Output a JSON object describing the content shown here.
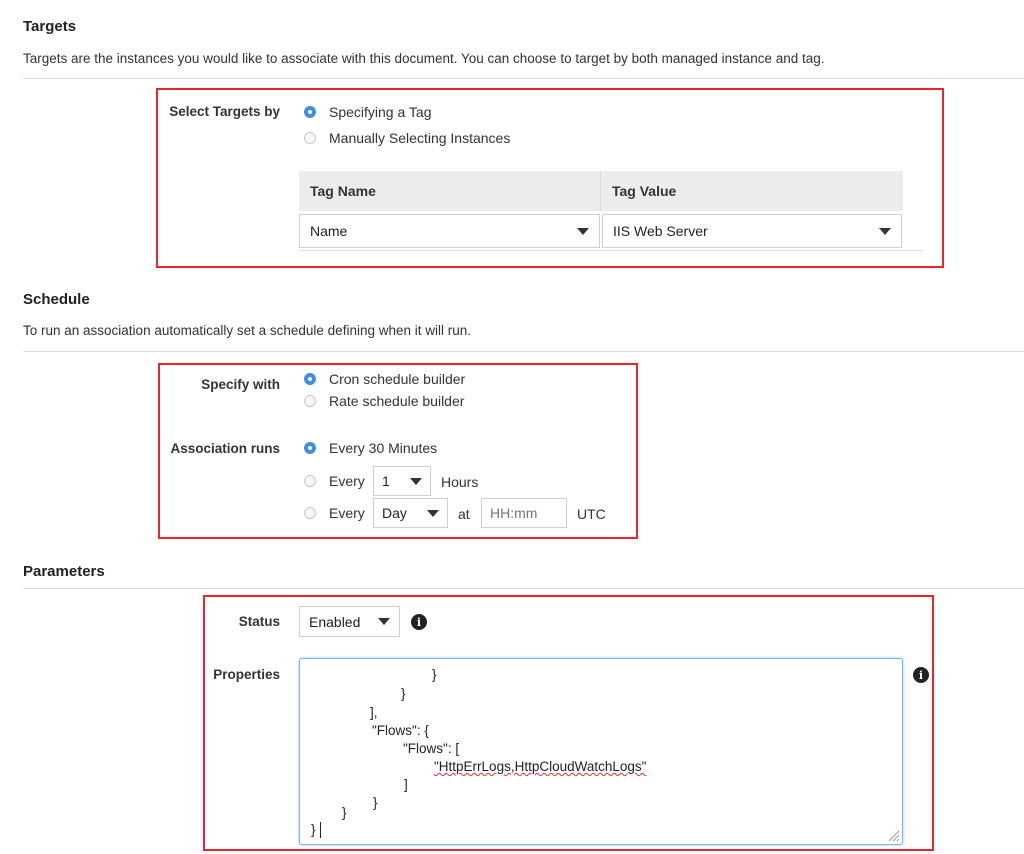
{
  "targets": {
    "heading": "Targets",
    "description": "Targets are the instances you would like to associate with this document. You can choose to target by both managed instance and tag.",
    "select_by_label": "Select Targets by",
    "options": [
      "Specifying a Tag",
      "Manually Selecting Instances"
    ],
    "selected_option": 0,
    "table": {
      "headers": [
        "Tag Name",
        "Tag Value"
      ],
      "tag_name": "Name",
      "tag_value": "IIS Web Server"
    }
  },
  "schedule": {
    "heading": "Schedule",
    "description": "To run an association automatically set a schedule defining when it will run.",
    "specify_with_label": "Specify with",
    "specify_options": [
      "Cron schedule builder",
      "Rate schedule builder"
    ],
    "association_runs_label": "Association runs",
    "run_option_1": "Every 30 Minutes",
    "every_label": "Every",
    "hours_value": "1",
    "hours_label": "Hours",
    "day_value": "Day",
    "at_label": "at",
    "time_placeholder": "HH:mm",
    "utc_label": "UTC"
  },
  "parameters": {
    "heading": "Parameters",
    "status_label": "Status",
    "status_value": "Enabled",
    "properties_label": "Properties",
    "code_lines": [
      "}",
      "}",
      "],",
      "\"Flows\": {",
      "\"Flows\": [",
      "\"HttpErrLogs,HttpCloudWatchLogs\"",
      "]",
      "}",
      "}",
      "}"
    ]
  },
  "colors": {
    "highlight_border": "#e8262b",
    "radio_selected": "#3b8fe6",
    "textarea_focus": "#7ab4e8"
  },
  "icons": [
    "chevron-down-icon",
    "info-icon",
    "resize-grip-icon"
  ]
}
